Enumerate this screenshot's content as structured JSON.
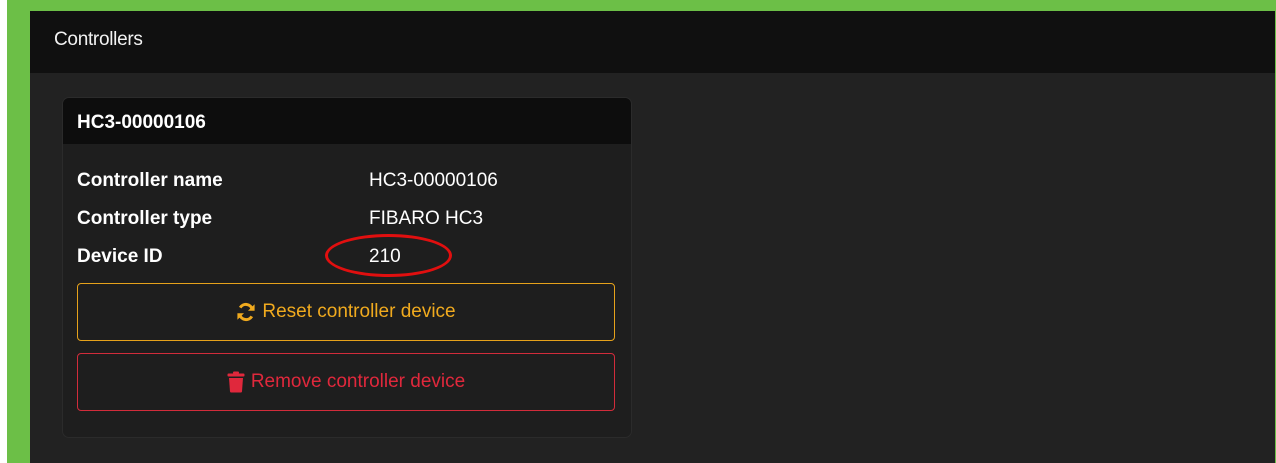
{
  "panel": {
    "title": "Controllers"
  },
  "controller": {
    "header": "HC3-00000106",
    "fields": [
      {
        "label": "Controller name",
        "value": "HC3-00000106"
      },
      {
        "label": "Controller type",
        "value": "FIBARO HC3"
      },
      {
        "label": "Device ID",
        "value": "210"
      }
    ],
    "actions": {
      "reset_label": "Reset controller device",
      "remove_label": "Remove controller device"
    }
  },
  "icons": {
    "reset": "refresh-icon",
    "remove": "trash-icon"
  },
  "colors": {
    "accent_bar": "#6cbf47",
    "panel_bg": "#222222",
    "header_bg": "#101010",
    "reset": "#f0aa1e",
    "remove": "#e0283c",
    "annotation": "#e10f0f"
  }
}
